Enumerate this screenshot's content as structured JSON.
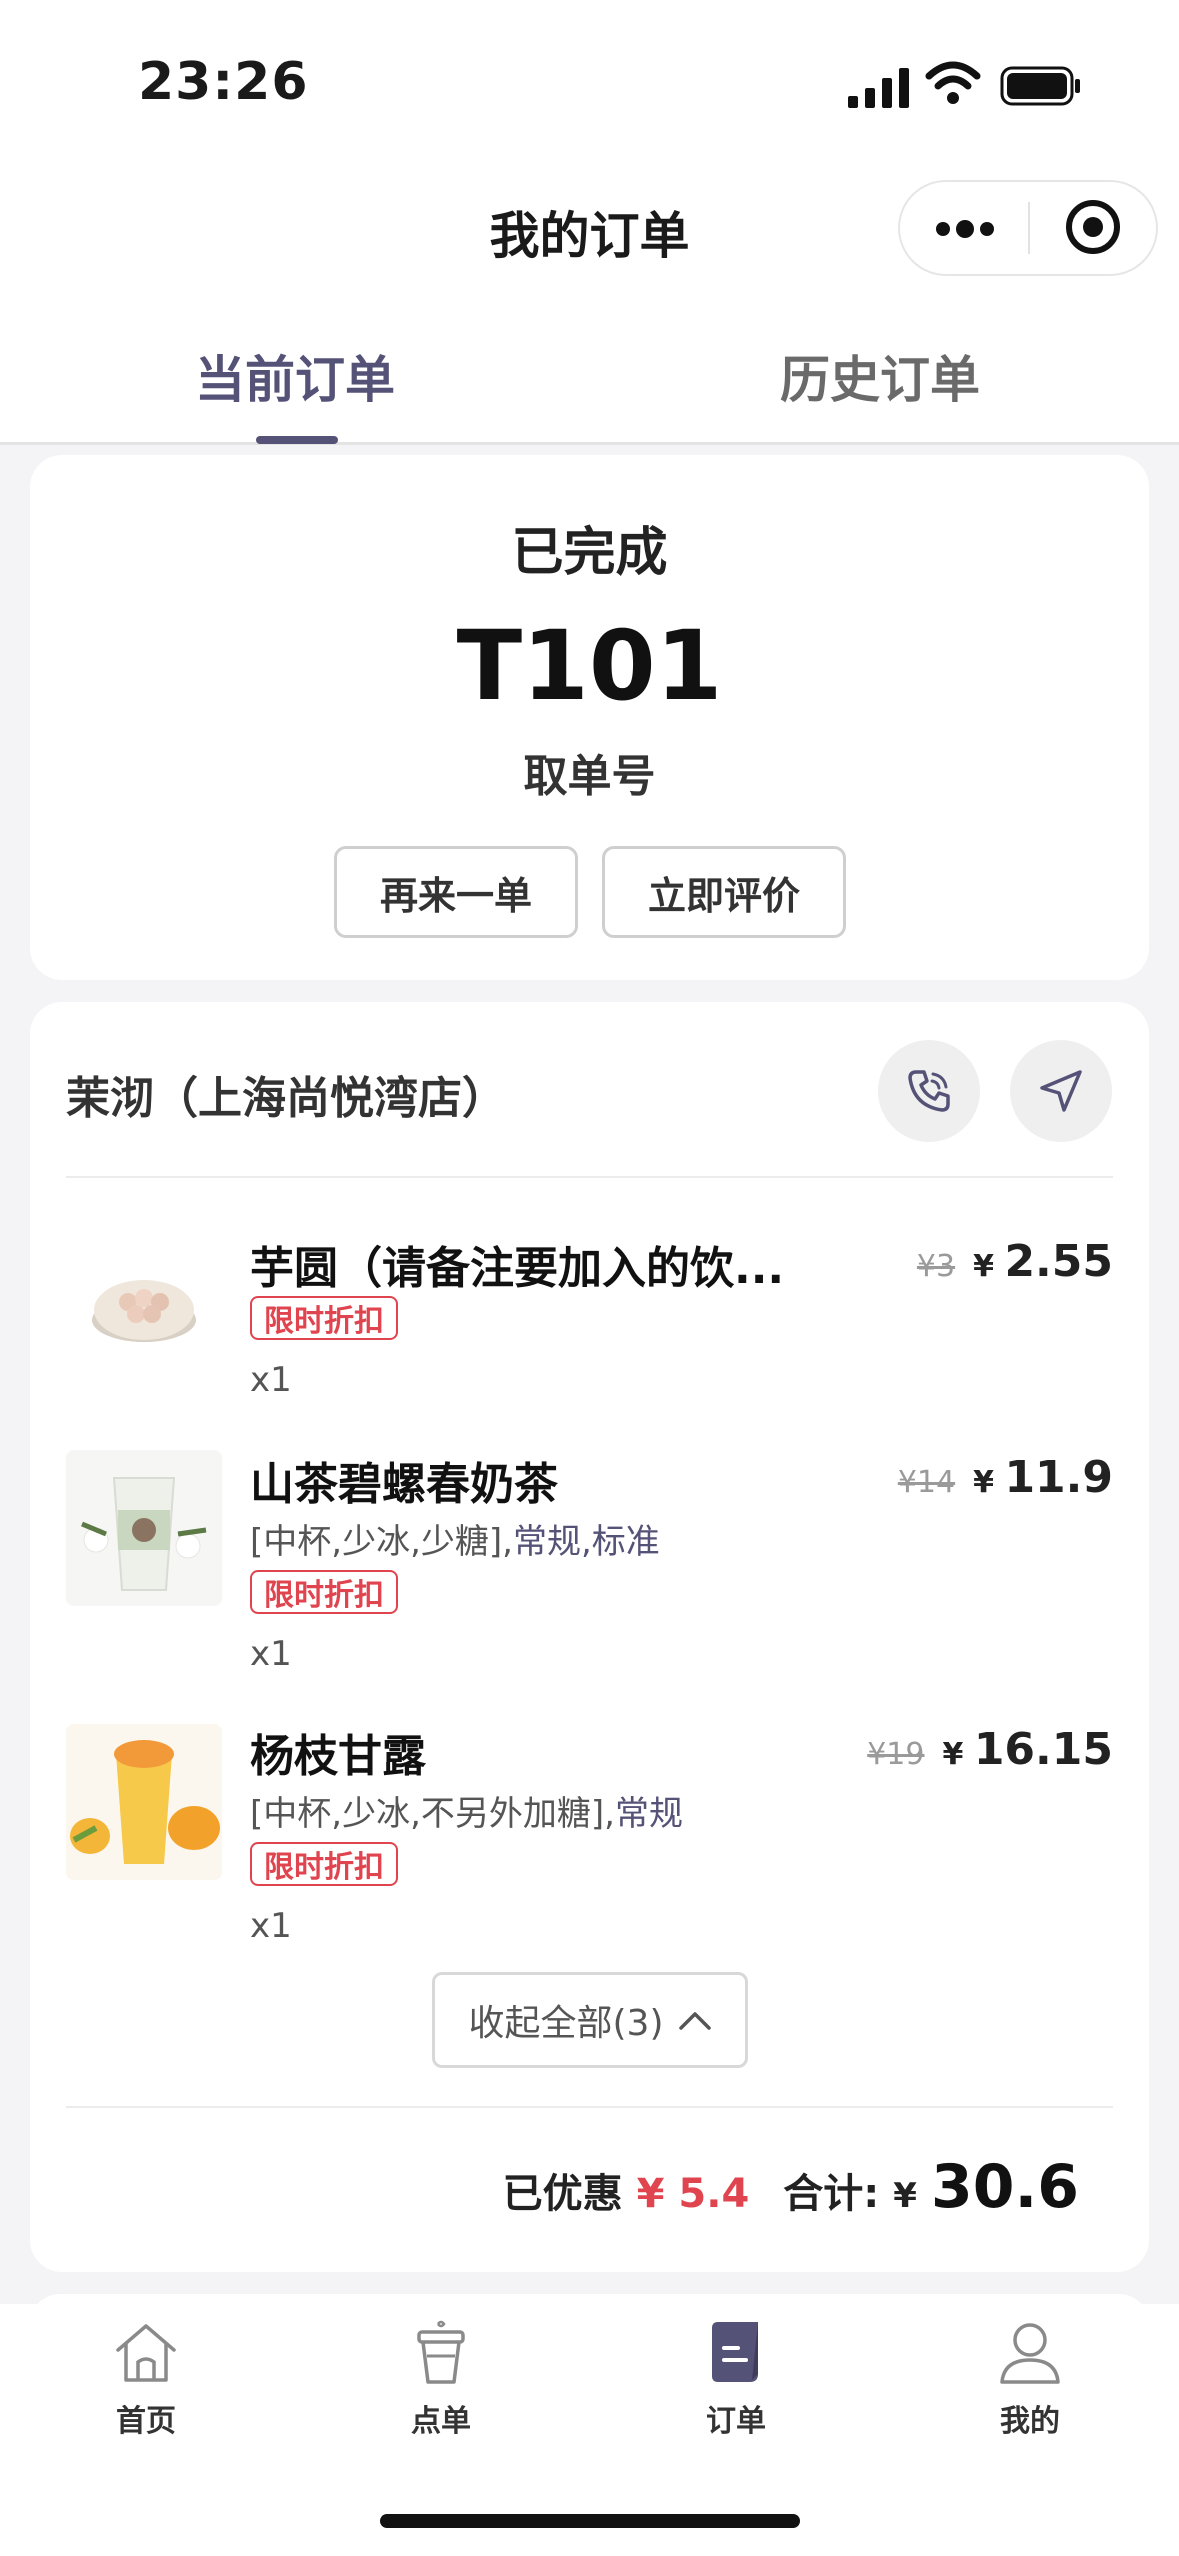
{
  "status_bar": {
    "time": "23:26",
    "icons": [
      "cellular-signal-icon",
      "wifi-icon",
      "battery-icon"
    ]
  },
  "nav": {
    "title": "我的订单",
    "capsule_icons": [
      "more-dots-icon",
      "close-target-icon"
    ]
  },
  "tabs": [
    {
      "label": "当前订单",
      "active": true
    },
    {
      "label": "历史订单",
      "active": false
    }
  ],
  "order": {
    "status": "已完成",
    "pickup_number": "T101",
    "pickup_label": "取单号",
    "actions": {
      "reorder": "再来一单",
      "review": "立即评价"
    },
    "store": {
      "name": "茉沏（上海尚悦湾店）"
    },
    "items": [
      {
        "name": "芋圆（请备注要加入的饮...",
        "spec_plain": "",
        "spec_highlight": "",
        "tag": "限时折扣",
        "quantity": "x1",
        "original_price": "¥3",
        "currency": "¥",
        "price": "2.55"
      },
      {
        "name": "山茶碧螺春奶茶",
        "spec_plain": "[中杯,少冰,少糖],",
        "spec_highlight": "常规,标准",
        "tag": "限时折扣",
        "quantity": "x1",
        "original_price": "¥14",
        "currency": "¥",
        "price": "11.9"
      },
      {
        "name": "杨枝甘露",
        "spec_plain": "[中杯,少冰,不另外加糖],",
        "spec_highlight": "常规",
        "tag": "限时折扣",
        "quantity": "x1",
        "original_price": "¥19",
        "currency": "¥",
        "price": "16.15"
      }
    ],
    "collapse_label": "收起全部(3)",
    "summary": {
      "discount_label": "已优惠",
      "discount_value": "¥ 5.4",
      "total_label": "合计:",
      "currency": "¥",
      "total_value": "30.6"
    }
  },
  "tabbar": [
    {
      "label": "首页",
      "icon": "home-icon"
    },
    {
      "label": "点单",
      "icon": "cup-icon"
    },
    {
      "label": "订单",
      "icon": "order-icon",
      "active": true
    },
    {
      "label": "我的",
      "icon": "profile-icon"
    }
  ],
  "colors": {
    "accent": "#555277",
    "discount_red": "#e0454f",
    "page_bg": "#f4f4f6"
  }
}
